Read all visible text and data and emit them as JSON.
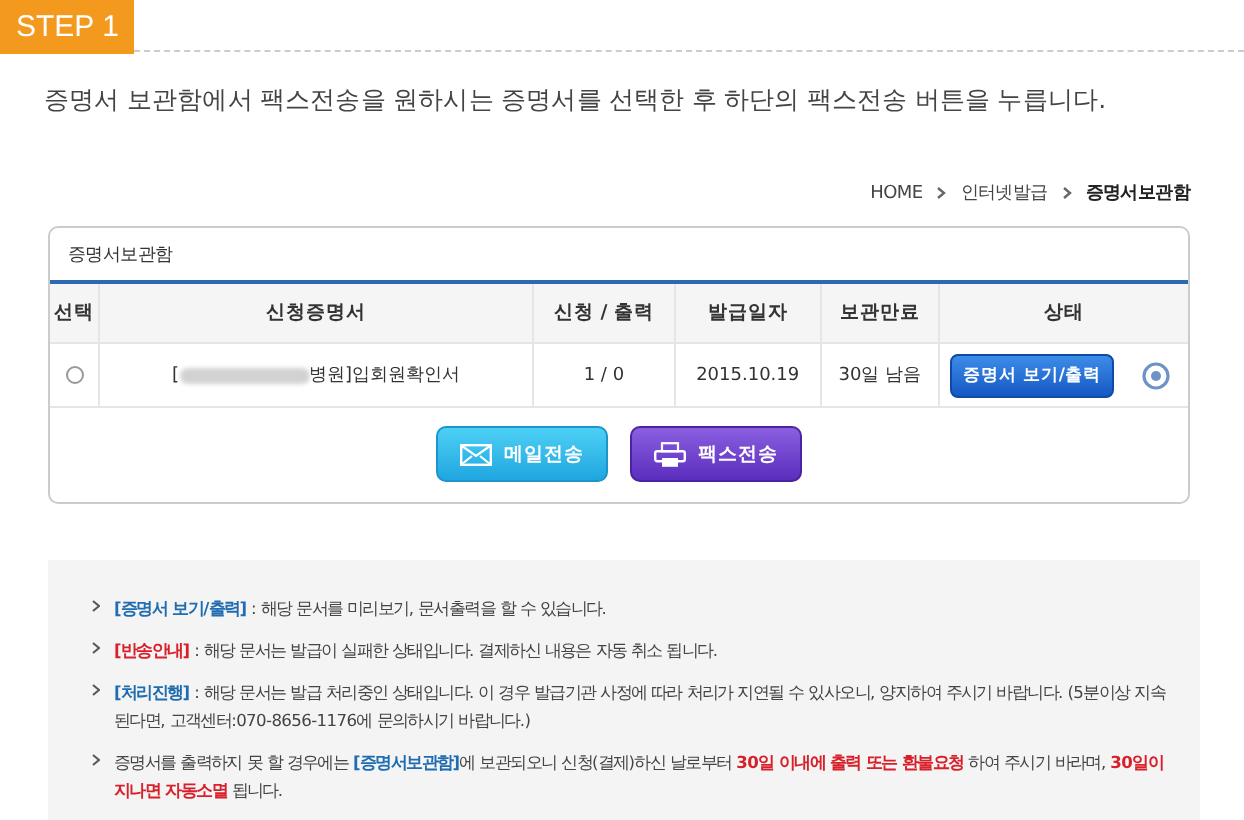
{
  "step": "STEP 1",
  "instruction": "증명서 보관함에서 팩스전송을 원하시는 증명서를 선택한 후 하단의 팩스전송 버튼을 누릅니다.",
  "breadcrumb": [
    {
      "label": "HOME",
      "current": false
    },
    {
      "label": "인터넷발급",
      "current": false
    },
    {
      "label": "증명서보관함",
      "current": true
    }
  ],
  "panel": {
    "title": "증명서보관함",
    "columns": [
      "선택",
      "신청증명서",
      "신청 / 출력",
      "발급일자",
      "보관만료",
      "상태"
    ],
    "rows": [
      {
        "selected": false,
        "cert_open": "[",
        "cert_rest": "병원]입회원확인서",
        "counts": "1 / 0",
        "issued": "2015.10.19",
        "expiry": "30일 남음",
        "view_button": "증명서 보기/출력"
      }
    ],
    "buttons": [
      {
        "kind": "mail",
        "label": "메일전송"
      },
      {
        "kind": "fax",
        "label": "팩스전송"
      }
    ]
  },
  "notes": [
    {
      "text": "**[증명서 보기/출력]** : 해당 문서를 미리보기, 문서출력을 할 수 있습니다."
    },
    {
      "text": "*[반송안내]* : 해당 문서는 발급이 실패한 상태입니다. 결제하신 내용은 자동 취소 됩니다."
    },
    {
      "text": "**[처리진행]** : 해당 문서는 발급 처리중인 상태입니다. 이 경우 발급기관 사정에 따라 처리가 지연될 수 있사오니, 양지하여 주시기 바랍니다. (5분이상 지속된다면, 고객센터:070-8656-1176에 문의하시기 바랍니다.)"
    },
    {
      "text": "증명서를 출력하지 못 할 경우에는 **[증명서보관함]**에 보관되오니 신청(결제)하신 날로부터 *30일 이내에 출력 또는 환불요청* 하여 주시기 바라며, *30일이 지나면 자동소멸* 됩니다."
    }
  ]
}
